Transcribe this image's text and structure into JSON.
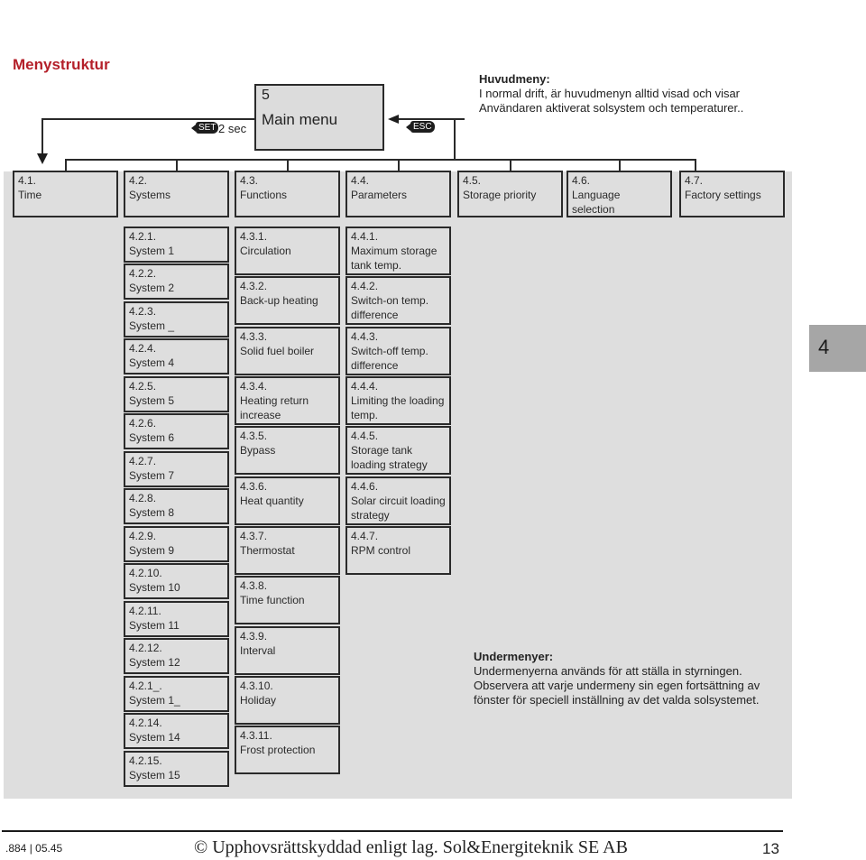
{
  "title": "Menystruktur",
  "main_menu": {
    "number": "5",
    "label": "Main menu"
  },
  "keys": {
    "set_label": "SET",
    "set_hold": "2 sec",
    "esc_label": "ESC"
  },
  "note_top": {
    "heading": "Huvudmeny:",
    "lines": [
      "I normal drift, är huvudmenyn alltid visad och visar",
      "Användaren aktiverat solsystem och temperaturer.."
    ]
  },
  "top_menus": [
    {
      "code": "4.1.",
      "name": "Time"
    },
    {
      "code": "4.2.",
      "name": "Systems"
    },
    {
      "code": "4.3.",
      "name": "Functions"
    },
    {
      "code": "4.4.",
      "name": "Parameters"
    },
    {
      "code": "4.5.",
      "name": "Storage priority"
    },
    {
      "code": "4.6.",
      "name": "Language selection"
    },
    {
      "code": "4.7.",
      "name": "Factory settings"
    }
  ],
  "systems": [
    {
      "code": "4.2.1.",
      "name": "System 1"
    },
    {
      "code": "4.2.2.",
      "name": "System 2"
    },
    {
      "code": "4.2.3.",
      "name": "System _"
    },
    {
      "code": "4.2.4.",
      "name": "System 4"
    },
    {
      "code": "4.2.5.",
      "name": "System 5"
    },
    {
      "code": "4.2.6.",
      "name": "System 6"
    },
    {
      "code": "4.2.7.",
      "name": "System 7"
    },
    {
      "code": "4.2.8.",
      "name": "System 8"
    },
    {
      "code": "4.2.9.",
      "name": "System 9"
    },
    {
      "code": "4.2.10.",
      "name": "System 10"
    },
    {
      "code": "4.2.11.",
      "name": "System 11"
    },
    {
      "code": "4.2.12.",
      "name": "System 12"
    },
    {
      "code": "4.2.1_.",
      "name": "System 1_"
    },
    {
      "code": "4.2.14.",
      "name": "System 14"
    },
    {
      "code": "4.2.15.",
      "name": "System 15"
    }
  ],
  "functions": [
    {
      "code": "4.3.1.",
      "name": "Circulation"
    },
    {
      "code": "4.3.2.",
      "name": "Back-up heating"
    },
    {
      "code": "4.3.3.",
      "name": "Solid fuel boiler"
    },
    {
      "code": "4.3.4.",
      "name": "Heating return increase"
    },
    {
      "code": "4.3.5.",
      "name": "Bypass"
    },
    {
      "code": "4.3.6.",
      "name": "Heat quantity"
    },
    {
      "code": "4.3.7.",
      "name": "Thermostat"
    },
    {
      "code": "4.3.8.",
      "name": "Time function"
    },
    {
      "code": "4.3.9.",
      "name": "Interval"
    },
    {
      "code": "4.3.10.",
      "name": "Holiday"
    },
    {
      "code": "4.3.11.",
      "name": "Frost protection"
    }
  ],
  "parameters": [
    {
      "code": "4.4.1.",
      "name": "Maximum storage tank temp."
    },
    {
      "code": "4.4.2.",
      "name": "Switch-on temp. difference"
    },
    {
      "code": "4.4.3.",
      "name": "Switch-off temp. difference"
    },
    {
      "code": "4.4.4.",
      "name": "Limiting the loading temp."
    },
    {
      "code": "4.4.5.",
      "name": "Storage tank loading strategy"
    },
    {
      "code": "4.4.6.",
      "name": "Solar circuit loading strategy"
    },
    {
      "code": "4.4.7.",
      "name": "RPM control"
    }
  ],
  "note_bottom": {
    "heading": "Undermenyer:",
    "text": "Undermenyerna används för att ställa in styrningen. Observera att varje undermeny sin egen fortsättning av fönster för speciell inställning av  det valda solsystemet."
  },
  "chapter_tab": "4",
  "footer": {
    "left": ".884 | 05.45",
    "center": "© Upphovsrättskyddad enligt lag. Sol&Energiteknik SE AB",
    "page": "13"
  }
}
